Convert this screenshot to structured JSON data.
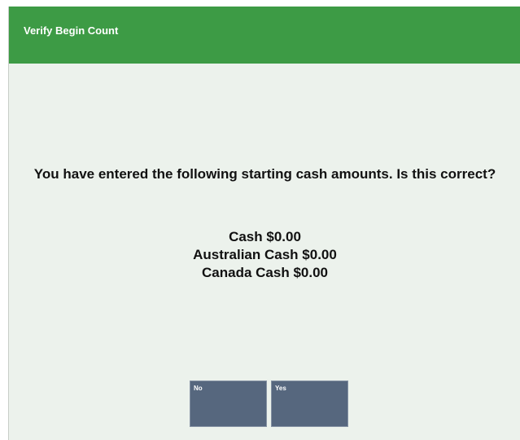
{
  "window": {
    "title": "Verify Begin Count"
  },
  "message": {
    "prompt": "You have entered the following starting cash amounts. Is this correct?",
    "amounts": [
      "Cash $0.00",
      "Australian Cash $0.00",
      "Canada Cash $0.00"
    ]
  },
  "buttons": {
    "no_label": "No",
    "yes_label": "Yes"
  },
  "colors": {
    "titlebar": "#3d9b45",
    "background": "#ecf2ec",
    "button": "#56677e",
    "text": "#111111"
  }
}
